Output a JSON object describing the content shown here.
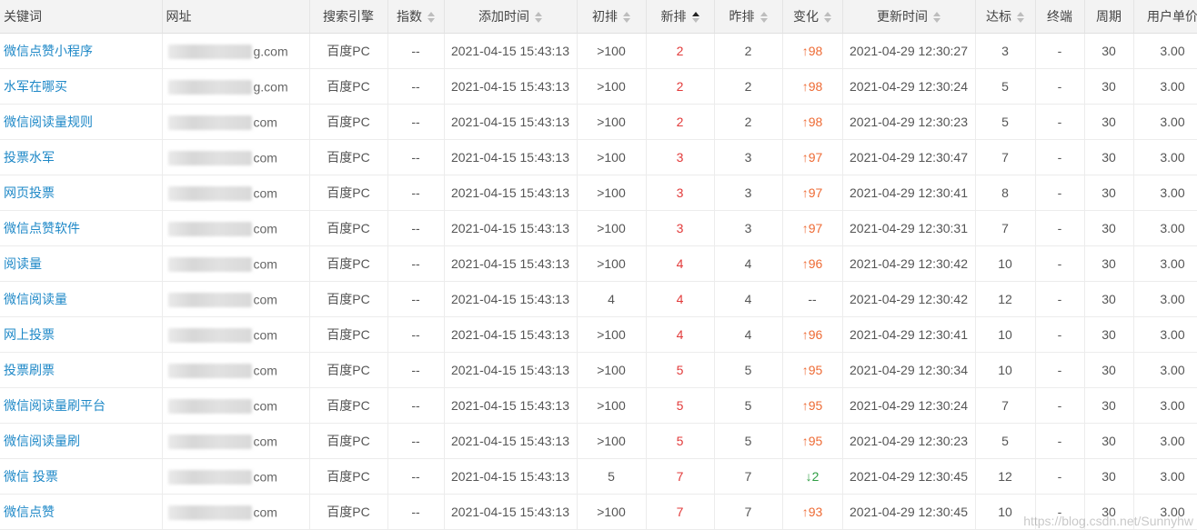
{
  "table": {
    "headers": [
      {
        "label": "关键词",
        "sortable": false
      },
      {
        "label": "网址",
        "sortable": false
      },
      {
        "label": "搜索引擎",
        "sortable": false
      },
      {
        "label": "指数",
        "sortable": true,
        "state": "none"
      },
      {
        "label": "添加时间",
        "sortable": true,
        "state": "none"
      },
      {
        "label": "初排",
        "sortable": true,
        "state": "none"
      },
      {
        "label": "新排",
        "sortable": true,
        "state": "asc"
      },
      {
        "label": "昨排",
        "sortable": true,
        "state": "none"
      },
      {
        "label": "变化",
        "sortable": true,
        "state": "none"
      },
      {
        "label": "更新时间",
        "sortable": true,
        "state": "none"
      },
      {
        "label": "达标",
        "sortable": true,
        "state": "none"
      },
      {
        "label": "终端",
        "sortable": false
      },
      {
        "label": "周期",
        "sortable": false
      },
      {
        "label": "用户单价",
        "sortable": false
      }
    ],
    "rows": [
      {
        "keyword": "微信点赞小程序",
        "url_tail": "g.com",
        "engine": "百度PC",
        "index": "--",
        "added": "2021-04-15 15:43:13",
        "initial": ">100",
        "new": "2",
        "yesterday": "2",
        "change": "↑98",
        "change_dir": "up",
        "updated": "2021-04-29 12:30:27",
        "reached": "3",
        "terminal": "-",
        "cycle": "30",
        "price": "3.00"
      },
      {
        "keyword": "水军在哪买",
        "url_tail": "g.com",
        "engine": "百度PC",
        "index": "--",
        "added": "2021-04-15 15:43:13",
        "initial": ">100",
        "new": "2",
        "yesterday": "2",
        "change": "↑98",
        "change_dir": "up",
        "updated": "2021-04-29 12:30:24",
        "reached": "5",
        "terminal": "-",
        "cycle": "30",
        "price": "3.00"
      },
      {
        "keyword": "微信阅读量规则",
        "url_tail": "com",
        "engine": "百度PC",
        "index": "--",
        "added": "2021-04-15 15:43:13",
        "initial": ">100",
        "new": "2",
        "yesterday": "2",
        "change": "↑98",
        "change_dir": "up",
        "updated": "2021-04-29 12:30:23",
        "reached": "5",
        "terminal": "-",
        "cycle": "30",
        "price": "3.00"
      },
      {
        "keyword": "投票水军",
        "url_tail": "com",
        "engine": "百度PC",
        "index": "--",
        "added": "2021-04-15 15:43:13",
        "initial": ">100",
        "new": "3",
        "yesterday": "3",
        "change": "↑97",
        "change_dir": "up",
        "updated": "2021-04-29 12:30:47",
        "reached": "7",
        "terminal": "-",
        "cycle": "30",
        "price": "3.00"
      },
      {
        "keyword": "网页投票",
        "url_tail": "com",
        "engine": "百度PC",
        "index": "--",
        "added": "2021-04-15 15:43:13",
        "initial": ">100",
        "new": "3",
        "yesterday": "3",
        "change": "↑97",
        "change_dir": "up",
        "updated": "2021-04-29 12:30:41",
        "reached": "8",
        "terminal": "-",
        "cycle": "30",
        "price": "3.00"
      },
      {
        "keyword": "微信点赞软件",
        "url_tail": "com",
        "engine": "百度PC",
        "index": "--",
        "added": "2021-04-15 15:43:13",
        "initial": ">100",
        "new": "3",
        "yesterday": "3",
        "change": "↑97",
        "change_dir": "up",
        "updated": "2021-04-29 12:30:31",
        "reached": "7",
        "terminal": "-",
        "cycle": "30",
        "price": "3.00"
      },
      {
        "keyword": "阅读量",
        "url_tail": "com",
        "engine": "百度PC",
        "index": "--",
        "added": "2021-04-15 15:43:13",
        "initial": ">100",
        "new": "4",
        "yesterday": "4",
        "change": "↑96",
        "change_dir": "up",
        "updated": "2021-04-29 12:30:42",
        "reached": "10",
        "terminal": "-",
        "cycle": "30",
        "price": "3.00"
      },
      {
        "keyword": "微信阅读量",
        "url_tail": "com",
        "engine": "百度PC",
        "index": "--",
        "added": "2021-04-15 15:43:13",
        "initial": "4",
        "new": "4",
        "yesterday": "4",
        "change": "--",
        "change_dir": "none",
        "updated": "2021-04-29 12:30:42",
        "reached": "12",
        "terminal": "-",
        "cycle": "30",
        "price": "3.00"
      },
      {
        "keyword": "网上投票",
        "url_tail": "com",
        "engine": "百度PC",
        "index": "--",
        "added": "2021-04-15 15:43:13",
        "initial": ">100",
        "new": "4",
        "yesterday": "4",
        "change": "↑96",
        "change_dir": "up",
        "updated": "2021-04-29 12:30:41",
        "reached": "10",
        "terminal": "-",
        "cycle": "30",
        "price": "3.00"
      },
      {
        "keyword": "投票刷票",
        "url_tail": "com",
        "engine": "百度PC",
        "index": "--",
        "added": "2021-04-15 15:43:13",
        "initial": ">100",
        "new": "5",
        "yesterday": "5",
        "change": "↑95",
        "change_dir": "up",
        "updated": "2021-04-29 12:30:34",
        "reached": "10",
        "terminal": "-",
        "cycle": "30",
        "price": "3.00"
      },
      {
        "keyword": "微信阅读量刷平台",
        "url_tail": "com",
        "engine": "百度PC",
        "index": "--",
        "added": "2021-04-15 15:43:13",
        "initial": ">100",
        "new": "5",
        "yesterday": "5",
        "change": "↑95",
        "change_dir": "up",
        "updated": "2021-04-29 12:30:24",
        "reached": "7",
        "terminal": "-",
        "cycle": "30",
        "price": "3.00"
      },
      {
        "keyword": "微信阅读量刷",
        "url_tail": "com",
        "engine": "百度PC",
        "index": "--",
        "added": "2021-04-15 15:43:13",
        "initial": ">100",
        "new": "5",
        "yesterday": "5",
        "change": "↑95",
        "change_dir": "up",
        "updated": "2021-04-29 12:30:23",
        "reached": "5",
        "terminal": "-",
        "cycle": "30",
        "price": "3.00"
      },
      {
        "keyword": "微信 投票",
        "url_tail": "com",
        "engine": "百度PC",
        "index": "--",
        "added": "2021-04-15 15:43:13",
        "initial": "5",
        "new": "7",
        "yesterday": "7",
        "change": "↓2",
        "change_dir": "down",
        "updated": "2021-04-29 12:30:45",
        "reached": "12",
        "terminal": "-",
        "cycle": "30",
        "price": "3.00"
      },
      {
        "keyword": "微信点赞",
        "url_tail": "com",
        "engine": "百度PC",
        "index": "--",
        "added": "2021-04-15 15:43:13",
        "initial": ">100",
        "new": "7",
        "yesterday": "7",
        "change": "↑93",
        "change_dir": "up",
        "updated": "2021-04-29 12:30:45",
        "reached": "10",
        "terminal": "-",
        "cycle": "30",
        "price": "3.00"
      }
    ]
  },
  "watermark": "https://blog.csdn.net/Sunnyhw",
  "colors": {
    "link": "#1e88c7",
    "rank_new": "#e23a3a",
    "change_up": "#ee6b35",
    "change_down": "#2f9e44"
  }
}
